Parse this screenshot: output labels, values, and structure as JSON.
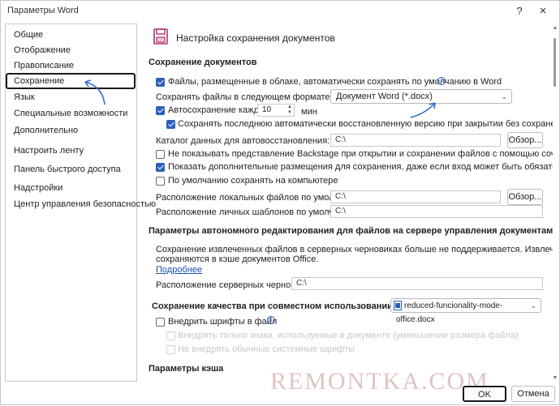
{
  "window": {
    "title": "Параметры Word",
    "help_label": "?",
    "close_label": "×"
  },
  "sidebar": {
    "items": [
      {
        "label": "Общие"
      },
      {
        "label": "Отображение"
      },
      {
        "label": "Правописание"
      },
      {
        "label": "Сохранение",
        "selected": true
      },
      {
        "label": "Язык"
      },
      {
        "label": "Специальные возможности"
      },
      {
        "label": "Дополнительно"
      },
      {
        "label": "Настроить ленту"
      },
      {
        "label": "Панель быстрого доступа"
      },
      {
        "label": "Надстройки"
      },
      {
        "label": "Центр управления безопасностью"
      }
    ]
  },
  "main": {
    "page_icon": "save-icon",
    "page_title": "Настройка сохранения документов",
    "save_section": {
      "title": "Сохранение документов",
      "cloud_autosave": {
        "label": "Файлы, размещенные в облаке, автоматически сохранять по умолчанию в Word",
        "checked": true
      },
      "format_label": "Сохранять файлы в следующем формате:",
      "format_value": "Документ Word (*.docx)",
      "autosave": {
        "label": "Автосохранение каждые",
        "checked": true,
        "value": "10",
        "unit": "мин"
      },
      "keep_last": {
        "label": "Сохранять последнюю автоматически восстановленную версию при закрытии без сохранения",
        "checked": true
      },
      "autorecover_label": "Каталог данных для автовосстановления:",
      "autorecover_path": "C:\\",
      "browse_label": "Обзор...",
      "no_backstage": {
        "label": "Не показывать представление Backstage при открытии и сохранении файлов с помощью сочетаний клавиш",
        "checked": false
      },
      "show_extra": {
        "label": "Показать дополнительные размещения для сохранения, даже если вход может быть обязательным",
        "checked": true
      },
      "default_computer": {
        "label": "По умолчанию сохранять на компьютере",
        "checked": false
      },
      "local_label": "Расположение локальных файлов по умолчанию:",
      "local_path": "C:\\",
      "templates_label": "Расположение личных шаблонов по умолчанию:",
      "templates_path": "C:\\"
    },
    "offline_section": {
      "title": "Параметры автономного редактирования для файлов на сервере управления документами",
      "text_line1": "Сохранение извлеченных файлов в серверных черновиках больше не поддерживается. Извлеченные файлы теперь",
      "text_line2": "сохраняются в кэше документов Office.",
      "more_link": "Подробнее",
      "drafts_label": "Расположение серверных черновиков:",
      "drafts_path": "C:\\"
    },
    "quality_section": {
      "title": "Сохранение качества при совместном использовании документа:",
      "doc_value": "reduced-funcionality-mode-office.docx",
      "embed_fonts": {
        "label": "Внедрить шрифты в файл",
        "checked": false
      },
      "faded_line1": "Внедрять только знаки, используемые в документе (уменьшение размера файла)",
      "faded_line2": "Не внедрять обычные системные шрифты"
    },
    "cache_section": {
      "title": "Параметры кэша"
    }
  },
  "footer": {
    "ok_label": "OK",
    "cancel_label": "Отмена"
  },
  "watermark": "REMONTKA.COM",
  "colors": {
    "accent": "#2b5fb8",
    "annotation_arrow": "#2f6fc9",
    "save_icon": "#b0306e"
  }
}
